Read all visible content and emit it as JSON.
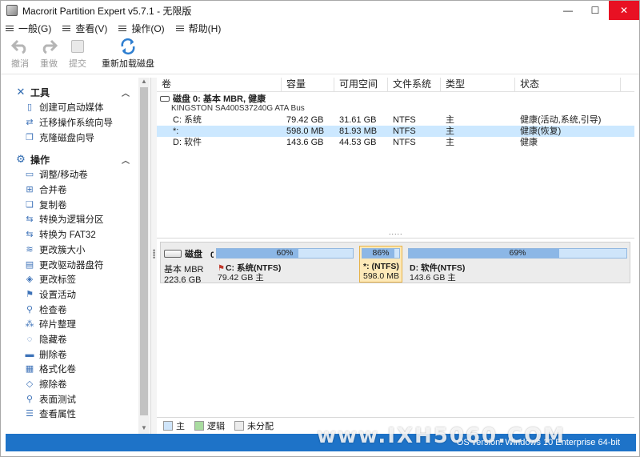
{
  "window": {
    "title": "Macrorit Partition Expert v5.7.1 - 无限版"
  },
  "titlebar_buttons": {
    "minimize": "—",
    "maximize": "☐",
    "close": "✕"
  },
  "menu": [
    {
      "label": "一般(G)"
    },
    {
      "label": "查看(V)"
    },
    {
      "label": "操作(O)"
    },
    {
      "label": "帮助(H)"
    }
  ],
  "toolbar": {
    "undo": "撤消",
    "redo": "重做",
    "commit": "提交",
    "reload": "重新加载磁盘"
  },
  "sidebar": {
    "tools_header": "工具",
    "tools": [
      {
        "label": "创建可启动媒体",
        "icon": "usb-icon"
      },
      {
        "label": "迁移操作系统向导",
        "icon": "migrate-icon"
      },
      {
        "label": "克隆磁盘向导",
        "icon": "clone-icon"
      }
    ],
    "ops_header": "操作",
    "ops": [
      {
        "label": "调整/移动卷",
        "icon": "resize-icon"
      },
      {
        "label": "合并卷",
        "icon": "merge-icon"
      },
      {
        "label": "复制卷",
        "icon": "copy-icon"
      },
      {
        "label": "转换为逻辑分区",
        "icon": "convert-icon"
      },
      {
        "label": "转换为 FAT32",
        "icon": "convert-fat-icon"
      },
      {
        "label": "更改簇大小",
        "icon": "cluster-icon"
      },
      {
        "label": "更改驱动器盘符",
        "icon": "drive-letter-icon"
      },
      {
        "label": "更改标签",
        "icon": "label-icon"
      },
      {
        "label": "设置活动",
        "icon": "flag-icon"
      },
      {
        "label": "检查卷",
        "icon": "check-icon"
      },
      {
        "label": "碎片整理",
        "icon": "defrag-icon"
      },
      {
        "label": "隐藏卷",
        "icon": "hide-icon"
      },
      {
        "label": "删除卷",
        "icon": "delete-icon"
      },
      {
        "label": "格式化卷",
        "icon": "format-icon"
      },
      {
        "label": "擦除卷",
        "icon": "wipe-icon"
      },
      {
        "label": "表面测试",
        "icon": "surface-test-icon"
      },
      {
        "label": "查看属性",
        "icon": "properties-icon"
      }
    ]
  },
  "table": {
    "columns": [
      "卷",
      "容量",
      "可用空间",
      "文件系统",
      "类型",
      "状态"
    ],
    "disk": {
      "title": "磁盘 0: 基本 MBR, 健康",
      "model": "KINGSTON SA400S37240G ATA Bus"
    },
    "rows": [
      {
        "vol": "C: 系统",
        "cap": "79.42 GB",
        "free": "31.61 GB",
        "fs": "NTFS",
        "type": "主",
        "status": "健康(活动,系统,引导)"
      },
      {
        "vol": "*:",
        "cap": "598.0 MB",
        "free": "81.93 MB",
        "fs": "NTFS",
        "type": "主",
        "status": "健康(恢复)"
      },
      {
        "vol": "D: 软件",
        "cap": "143.6 GB",
        "free": "44.53 GB",
        "fs": "NTFS",
        "type": "主",
        "status": "健康"
      }
    ],
    "more": "....."
  },
  "diskmap": {
    "name": "磁盘",
    "num": "0",
    "type": "基本 MBR",
    "size": "223.6 GB",
    "partitions": [
      {
        "pct": "60%",
        "used_fraction": 0.6,
        "name": "C: 系统(NTFS)",
        "size": "79.42 GB 主"
      },
      {
        "pct": "86%",
        "used_fraction": 0.86,
        "name": "*: (NTFS)",
        "size": "598.0 MB"
      },
      {
        "pct": "69%",
        "used_fraction": 0.69,
        "name": "D: 软件(NTFS)",
        "size": "143.6 GB 主"
      }
    ]
  },
  "legend": {
    "primary": "主",
    "logical": "逻辑",
    "unallocated": "未分配"
  },
  "colors": {
    "primary": "#cfe5fa",
    "logical": "#a9dca0",
    "unallocated": "#ececec",
    "status_bar": "#1e73c8",
    "selection": "#cce8ff"
  },
  "statusbar": {
    "os": "OS version: Windows 10 Enterprise 64-bit"
  },
  "watermark": "www.IXH5060.COM"
}
